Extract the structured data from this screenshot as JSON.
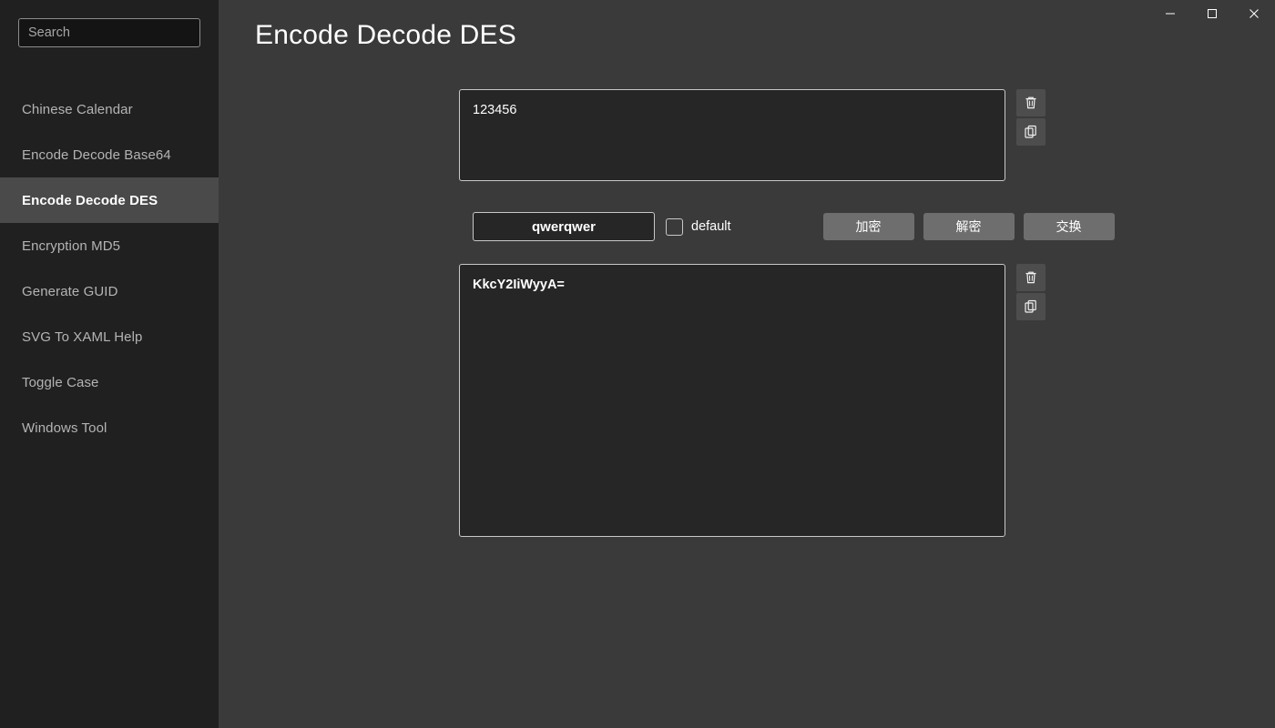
{
  "window": {
    "controls": [
      {
        "name": "minimize",
        "label": "—"
      },
      {
        "name": "maximize",
        "label": "□"
      },
      {
        "name": "close",
        "label": "✕"
      }
    ]
  },
  "sidebar": {
    "search": {
      "placeholder": "Search",
      "value": ""
    },
    "items": [
      {
        "label": "Chinese Calendar",
        "selected": false
      },
      {
        "label": "Encode Decode Base64",
        "selected": false
      },
      {
        "label": "Encode Decode DES",
        "selected": true
      },
      {
        "label": "Encryption MD5",
        "selected": false
      },
      {
        "label": "Generate GUID",
        "selected": false
      },
      {
        "label": "SVG To XAML Help",
        "selected": false
      },
      {
        "label": "Toggle Case",
        "selected": false
      },
      {
        "label": "Windows Tool",
        "selected": false
      }
    ]
  },
  "main": {
    "title": "Encode Decode DES",
    "input": {
      "value": "123456",
      "placeholder": ""
    },
    "output": {
      "value": "KkcY2IiWyyA=",
      "placeholder": ""
    },
    "input_actions": [
      {
        "name": "clear-input",
        "icon": "trash-icon"
      },
      {
        "name": "copy-input",
        "icon": "copy-icon"
      }
    ],
    "output_actions": [
      {
        "name": "clear-output",
        "icon": "trash-icon"
      },
      {
        "name": "copy-output",
        "icon": "copy-icon"
      }
    ],
    "key": {
      "value": "qwerqwer",
      "placeholder": ""
    },
    "default_checkbox": {
      "label": "default",
      "checked": false
    },
    "buttons": [
      {
        "label": "加密",
        "name": "encrypt-button"
      },
      {
        "label": "解密",
        "name": "decrypt-button"
      },
      {
        "label": "交换",
        "name": "swap-button"
      }
    ]
  },
  "colors": {
    "sidebar_bg": "#202020",
    "main_bg": "#3a3a3a",
    "selected_bg": "#4a4a4a",
    "field_bg": "#262626",
    "button_bg": "#6e6e6e",
    "border": "#c8c8c8",
    "text": "#ffffff",
    "muted_text": "#b4b4b4"
  }
}
